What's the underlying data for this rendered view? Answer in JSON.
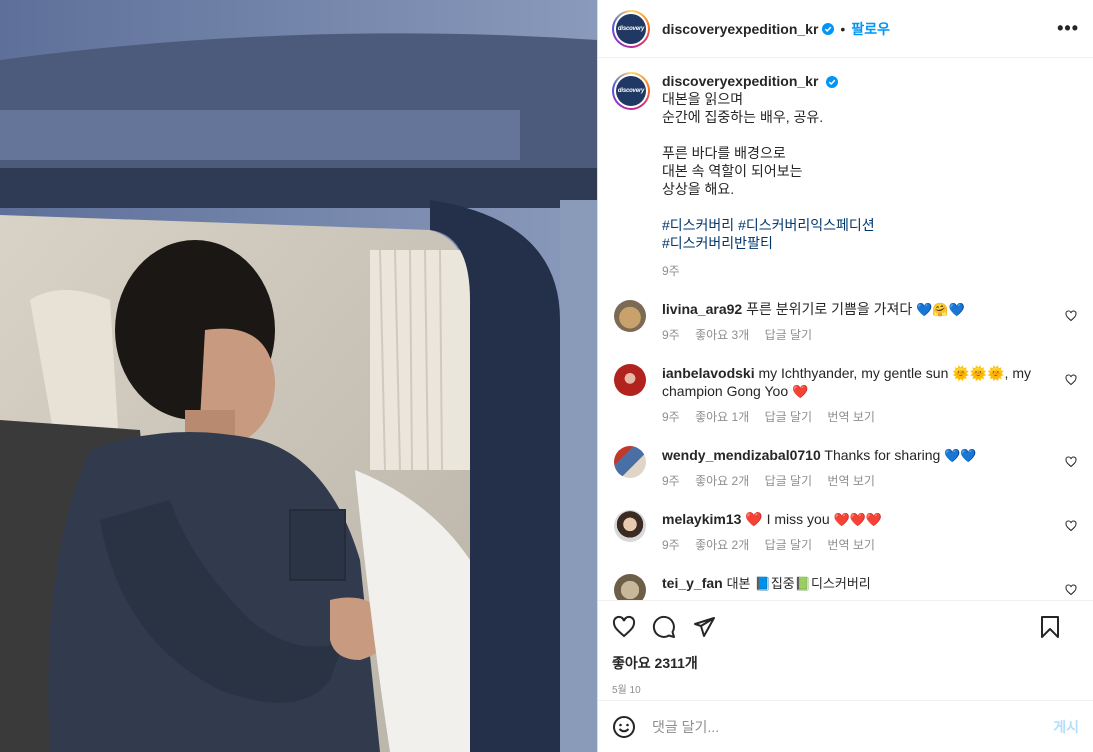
{
  "header": {
    "username": "discoveryexpedition_kr",
    "dot": "•",
    "follow_label": "팔로우",
    "more": "•••",
    "logo_text": "discovery"
  },
  "caption": {
    "username": "discoveryexpedition_kr",
    "lines": [
      "대본을 읽으며",
      "순간에 집중하는 배우, 공유.",
      "",
      "푸른 바다를 배경으로",
      "대본 속 역할이 되어보는",
      "상상을 해요."
    ],
    "hashtags": [
      "#디스커버리",
      "#디스커버리익스페디션",
      "#디스커버리반팔티"
    ],
    "time": "9주"
  },
  "comments": [
    {
      "user": "livina_ara92",
      "text": "푸른 분위기로 기쁨을 가져다",
      "emoji": "💙🤗💙",
      "time": "9주",
      "likes": "좋아요 3개",
      "reply": "답글 달기",
      "translate": ""
    },
    {
      "user": "ianbelavodski",
      "text": "my Ichthyander, my gentle sun 🌞🌞🌞, my champion Gong Yoo",
      "emoji": "❤️",
      "time": "9주",
      "likes": "좋아요 1개",
      "reply": "답글 달기",
      "translate": "번역 보기"
    },
    {
      "user": "wendy_mendizabal0710",
      "text": "Thanks for sharing",
      "emoji": "💙💙",
      "time": "9주",
      "likes": "좋아요 2개",
      "reply": "답글 달기",
      "translate": "번역 보기"
    },
    {
      "user": "melaykim13",
      "text": "❤️ I miss you",
      "emoji": "❤️❤️❤️",
      "time": "9주",
      "likes": "좋아요 2개",
      "reply": "답글 달기",
      "translate": "번역 보기"
    },
    {
      "user": "tei_y_fan",
      "text": "대본 📘집중📗디스커버리",
      "emoji": "",
      "time": "",
      "likes": "",
      "reply": "",
      "translate": ""
    }
  ],
  "actions": {
    "likes": "좋아요 2311개",
    "date": "5월 10"
  },
  "composer": {
    "placeholder": "댓글 달기...",
    "post_label": "게시"
  },
  "colors": {
    "accent": "#0095f6",
    "hashtag": "#00376b",
    "muted": "#8e8e8e",
    "brand_navy": "#1f3864"
  }
}
